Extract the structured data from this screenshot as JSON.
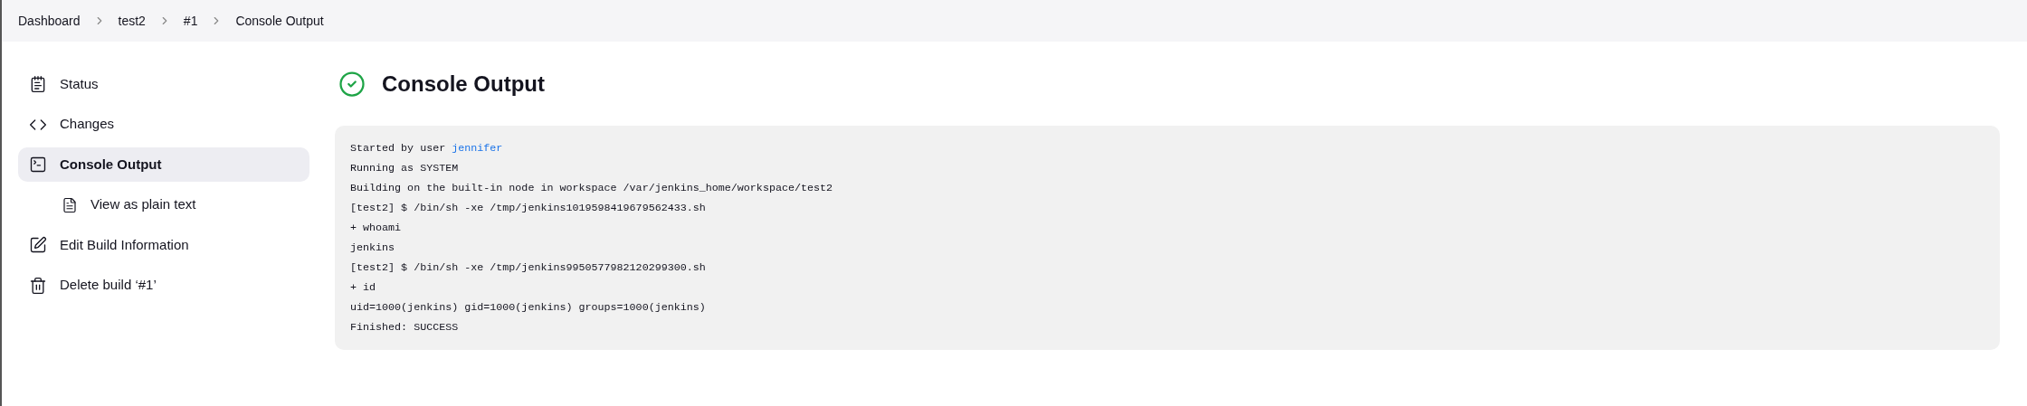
{
  "breadcrumbs": [
    "Dashboard",
    "test2",
    "#1",
    "Console Output"
  ],
  "sidebar": {
    "items": [
      {
        "label": "Status",
        "selected": false
      },
      {
        "label": "Changes",
        "selected": false
      },
      {
        "label": "Console Output",
        "selected": true,
        "children": [
          {
            "label": "View as plain text",
            "selected": false
          }
        ]
      },
      {
        "label": "Edit Build Information",
        "selected": false
      },
      {
        "label": "Delete build ‘#1’",
        "selected": false
      }
    ]
  },
  "main": {
    "title": "Console Output",
    "succeeded": true,
    "console_lines": [
      {
        "text": "Started by user ",
        "link": "jennifer"
      },
      {
        "text": "Running as SYSTEM"
      },
      {
        "text": "Building on the built-in node in workspace /var/jenkins_home/workspace/test2"
      },
      {
        "text": "[test2] $ /bin/sh -xe /tmp/jenkins1019598419679562433.sh"
      },
      {
        "text": "+ whoami"
      },
      {
        "text": "jenkins"
      },
      {
        "text": "[test2] $ /bin/sh -xe /tmp/jenkins9950577982120299300.sh"
      },
      {
        "text": "+ id"
      },
      {
        "text": "uid=1000(jenkins) gid=1000(jenkins) groups=1000(jenkins)"
      },
      {
        "text": "Finished: SUCCESS"
      }
    ]
  }
}
